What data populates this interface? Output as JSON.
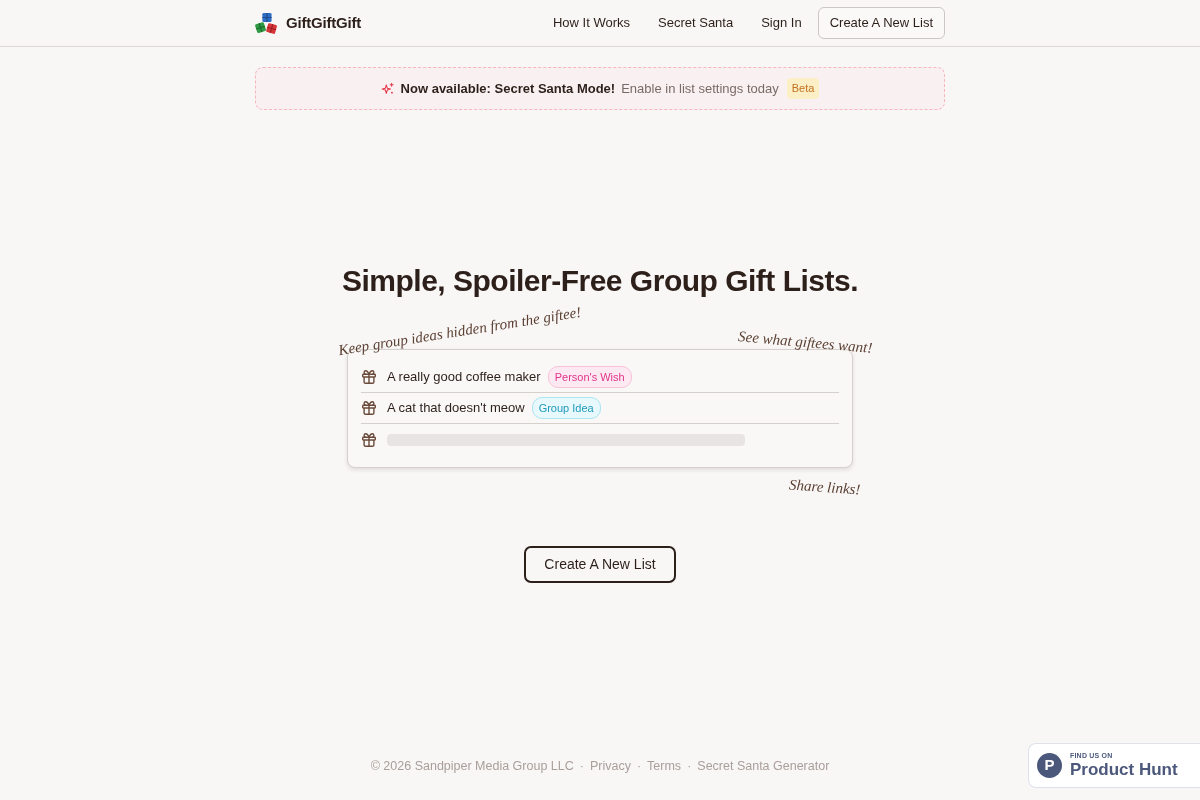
{
  "header": {
    "logo": "GiftGiftGift",
    "nav": [
      {
        "kind": "link",
        "label": "How It Works"
      },
      {
        "kind": "link",
        "label": "Secret Santa"
      },
      {
        "kind": "link",
        "label": "Sign In"
      },
      {
        "kind": "button",
        "label": "Create A New List"
      }
    ]
  },
  "announcement": {
    "title": "Now available: Secret Santa Mode!",
    "text": "Enable in list settings today",
    "badge": "Beta"
  },
  "hero": {
    "heading": "Simple, Spoiler-Free Group Gift Lists.",
    "annotations": [
      "Keep group ideas hidden from the giftee!",
      "See what giftees want!",
      "Share links!"
    ],
    "example_list": [
      {
        "kind": "item",
        "text": "A really good coffee maker",
        "tag": {
          "kind": "wish",
          "label": "Person's Wish"
        }
      },
      {
        "kind": "item",
        "text": "A cat that doesn't meow",
        "tag": {
          "kind": "group",
          "label": "Group Idea"
        }
      },
      {
        "kind": "placeholder"
      }
    ],
    "cta": "Create A New List"
  },
  "footer": {
    "copyright": "© 2026 Sandpiper Media Group LLC",
    "separator": "·",
    "links": [
      "Privacy",
      "Terms",
      "Secret Santa Generator"
    ]
  },
  "product_hunt_badge": {
    "logo_letter": "P",
    "eyebrow": "FIND US ON",
    "name": "Product Hunt"
  }
}
